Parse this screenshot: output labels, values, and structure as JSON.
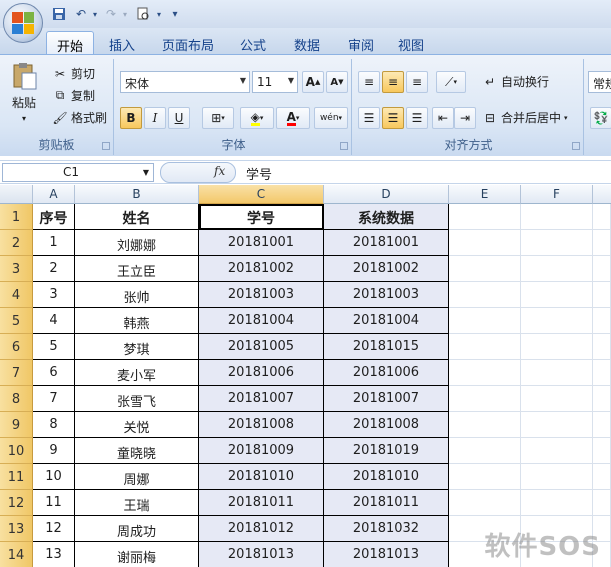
{
  "quick_access": {
    "icons": [
      "save-icon",
      "undo-icon",
      "redo-icon",
      "print-preview-icon",
      "customize-icon"
    ]
  },
  "tabs": [
    "开始",
    "插入",
    "页面布局",
    "公式",
    "数据",
    "审阅",
    "视图"
  ],
  "ribbon": {
    "clipboard": {
      "paste": "粘贴",
      "cut": "剪切",
      "copy": "复制",
      "format_painter": "格式刷",
      "label": "剪贴板"
    },
    "font": {
      "name": "宋体",
      "size": "11",
      "label": "字体",
      "grow": "A",
      "shrink": "A",
      "bold": "B",
      "italic": "I",
      "underline": "U",
      "phonetic": "wén"
    },
    "alignment": {
      "wrap": "自动换行",
      "merge": "合并后居中",
      "label": "对齐方式"
    },
    "number": {
      "format": "常规"
    }
  },
  "formula_bar": {
    "name_box": "C1",
    "fx": "fx",
    "content": "学号"
  },
  "columns": [
    "A",
    "B",
    "C",
    "D",
    "E",
    "F"
  ],
  "rows": [
    {
      "n": "1",
      "a": "序号",
      "b": "姓名",
      "c": "学号",
      "d": "系统数据"
    },
    {
      "n": "2",
      "a": "1",
      "b": "刘娜娜",
      "c": "20181001",
      "d": "20181001"
    },
    {
      "n": "3",
      "a": "2",
      "b": "王立臣",
      "c": "20181002",
      "d": "20181002"
    },
    {
      "n": "4",
      "a": "3",
      "b": "张帅",
      "c": "20181003",
      "d": "20181003"
    },
    {
      "n": "5",
      "a": "4",
      "b": "韩燕",
      "c": "20181004",
      "d": "20181004"
    },
    {
      "n": "6",
      "a": "5",
      "b": "梦琪",
      "c": "20181005",
      "d": "20181015"
    },
    {
      "n": "7",
      "a": "6",
      "b": "麦小军",
      "c": "20181006",
      "d": "20181006"
    },
    {
      "n": "8",
      "a": "7",
      "b": "张雪飞",
      "c": "20181007",
      "d": "20181007"
    },
    {
      "n": "9",
      "a": "8",
      "b": "关悦",
      "c": "20181008",
      "d": "20181008"
    },
    {
      "n": "10",
      "a": "9",
      "b": "童晓晓",
      "c": "20181009",
      "d": "20181019"
    },
    {
      "n": "11",
      "a": "10",
      "b": "周娜",
      "c": "20181010",
      "d": "20181010"
    },
    {
      "n": "12",
      "a": "11",
      "b": "王瑞",
      "c": "20181011",
      "d": "20181011"
    },
    {
      "n": "13",
      "a": "12",
      "b": "周成功",
      "c": "20181012",
      "d": "20181032"
    },
    {
      "n": "14",
      "a": "13",
      "b": "谢丽梅",
      "c": "20181013",
      "d": "20181013"
    }
  ],
  "watermark": "软件SOS"
}
